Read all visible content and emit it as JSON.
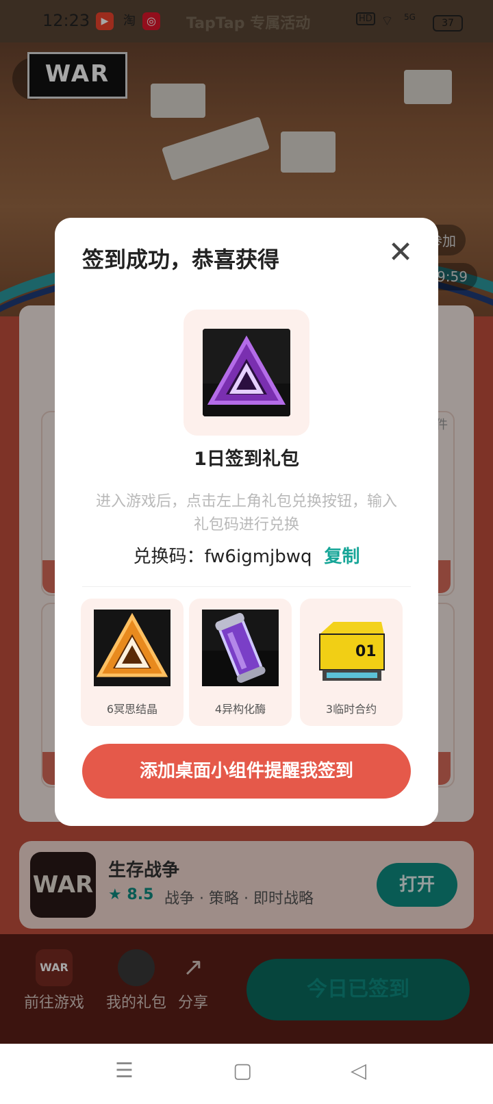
{
  "status_bar": {
    "time": "12:23",
    "app1": "▶",
    "app2": "淘",
    "app3": "◎",
    "center": "TapTap 专属活动",
    "hd": "HD",
    "signal": "5G",
    "battery": "37"
  },
  "hero": {
    "back_icon": "‹",
    "logo_text": "WAR"
  },
  "bg_chips": {
    "join": "参加",
    "timer": "9:59",
    "side_tag": "件"
  },
  "modal": {
    "title": "签到成功，恭喜获得",
    "close_icon": "✕",
    "gift_name": "1日签到礼包",
    "gift_desc": "进入游戏后，点击左上角礼包兑换按钮，输入礼包码进行兑换",
    "code_label": "兑换码：",
    "code_value": "fw6igmjbwq",
    "copy_label": "复制",
    "items": [
      {
        "label": "6冥思结晶",
        "icon": "crystal-icon"
      },
      {
        "label": "4异构化酶",
        "icon": "enzyme-vial-icon"
      },
      {
        "label": "3临时合约",
        "icon": "contract-crate-icon"
      }
    ],
    "add_widget_label": "添加桌面小组件提醒我签到",
    "crate_text": "01"
  },
  "game": {
    "name": "生存战争",
    "rating": "8.5",
    "tags": "战争 · 策略 · 即时战略",
    "open_label": "打开",
    "icon_text": "WAR"
  },
  "bottom_bar": {
    "goto_game": "前往游戏",
    "my_gifts": "我的礼包",
    "share": "分享",
    "checked_in": "今日已签到"
  },
  "nav": {
    "menu": "☰",
    "home": "▢",
    "back": "◁"
  }
}
